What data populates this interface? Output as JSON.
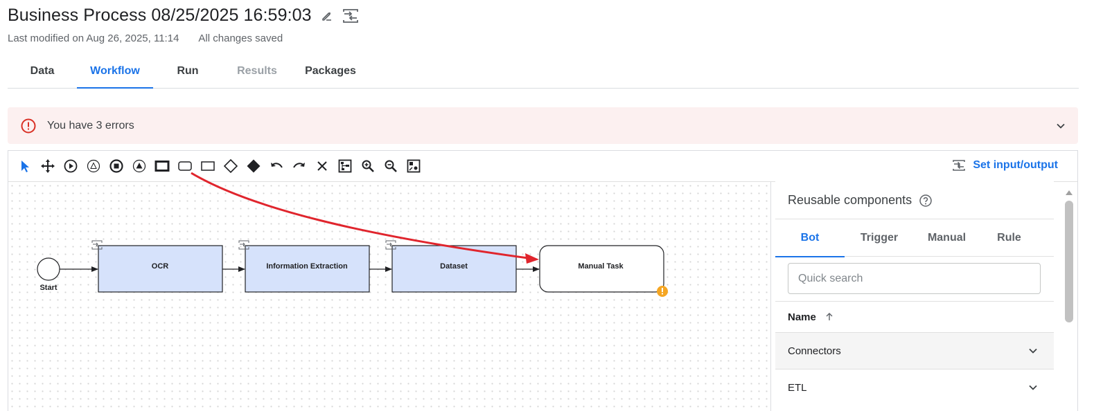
{
  "header": {
    "title": "Business Process 08/25/2025 16:59:03",
    "last_modified": "Last modified on Aug 26, 2025, 11:14",
    "save_status": "All changes saved",
    "edit_icon": "pencil-icon",
    "io_icon": "input-output-icon"
  },
  "tabs": [
    {
      "label": "Data",
      "state": "normal"
    },
    {
      "label": "Workflow",
      "state": "active"
    },
    {
      "label": "Run",
      "state": "normal"
    },
    {
      "label": "Results",
      "state": "disabled"
    },
    {
      "label": "Packages",
      "state": "normal"
    }
  ],
  "error_banner": {
    "text": "You have 3 errors",
    "icon": "error-circle-icon"
  },
  "toolbar": {
    "tools": [
      "pointer-icon",
      "pan-icon",
      "start-event-icon",
      "intermediate-event-icon",
      "end-event-icon",
      "trigger-event-icon",
      "task-bold-icon",
      "rounded-task-icon",
      "rect-task-icon",
      "gateway-icon",
      "exclusive-gateway-icon",
      "undo-icon",
      "redo-icon",
      "delete-icon",
      "auto-layout-icon",
      "zoom-in-icon",
      "zoom-out-icon",
      "fit-view-icon"
    ],
    "set_io_label": "Set input/output"
  },
  "diagram": {
    "start_label": "Start",
    "tasks": [
      {
        "label": "OCR",
        "kind": "bot"
      },
      {
        "label": "Information Extraction",
        "kind": "bot"
      },
      {
        "label": "Dataset",
        "kind": "bot"
      },
      {
        "label": "Manual Task",
        "kind": "manual",
        "warning": true
      }
    ]
  },
  "panel": {
    "title": "Reusable components",
    "help_icon": "help-icon",
    "tabs": [
      {
        "label": "Bot",
        "active": true
      },
      {
        "label": "Trigger",
        "active": false
      },
      {
        "label": "Manual",
        "active": false
      },
      {
        "label": "Rule",
        "active": false
      }
    ],
    "search_placeholder": "Quick search",
    "name_header": "Name",
    "groups": [
      {
        "label": "Connectors"
      },
      {
        "label": "ETL"
      }
    ]
  },
  "colors": {
    "accent": "#1a73e8",
    "error": "#d93025",
    "error_bg": "#fcf0f0",
    "task_fill": "#d6e2fb",
    "warning": "#f5a623",
    "annotation_arrow": "#e0252d"
  }
}
